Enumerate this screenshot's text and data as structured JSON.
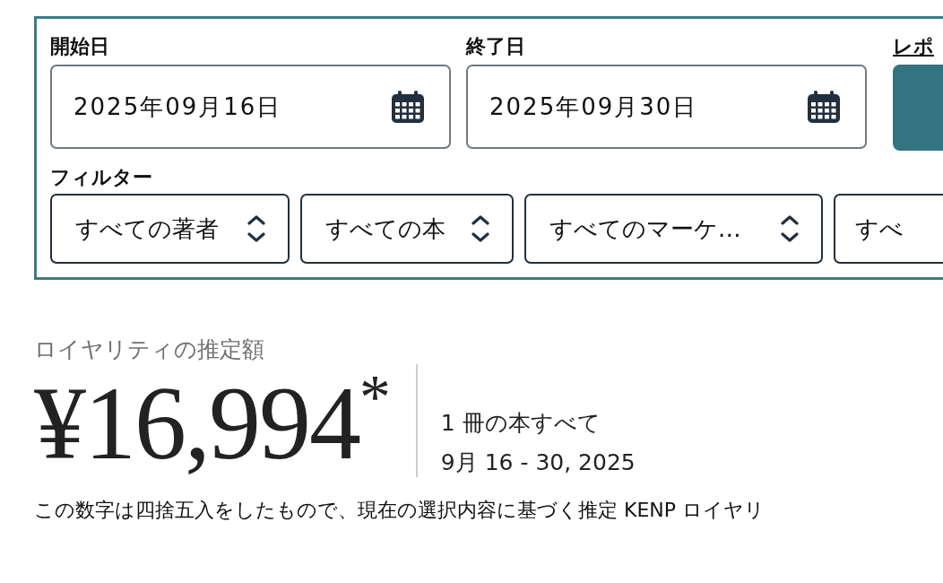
{
  "date_range": {
    "start": {
      "label": "開始日",
      "value": "2025年09月16日"
    },
    "end": {
      "label": "終了日",
      "value": "2025年09月30日"
    }
  },
  "report": {
    "label": "レポ"
  },
  "filters": {
    "label": "フィルター",
    "items": [
      {
        "value": "すべての著者"
      },
      {
        "value": "すべての本"
      },
      {
        "value": "すべてのマーケ…"
      },
      {
        "value": "すべ"
      }
    ]
  },
  "royalty": {
    "label": "ロイヤリティの推定額",
    "amount": "¥16,994$^{*}$",
    "scope": "1 冊の本すべて",
    "period": "9月 16 - 30, 2025",
    "note": "この数字は四捨五入をしたもので、現在の選択内容に基づく推定 KENP ロイヤリ"
  }
}
